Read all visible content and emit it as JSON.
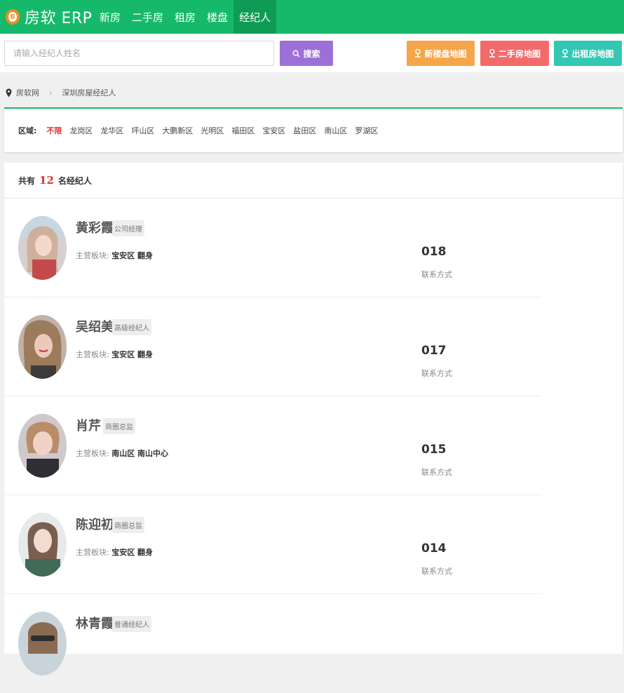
{
  "nav": {
    "brand": "房软 ERP",
    "logo_glyph": "8",
    "items": [
      {
        "label": "新房",
        "active": false
      },
      {
        "label": "二手房",
        "active": false
      },
      {
        "label": "租房",
        "active": false
      },
      {
        "label": "楼盘",
        "active": false
      },
      {
        "label": "经纪人",
        "active": true
      }
    ]
  },
  "search": {
    "placeholder": "请输入经纪人姓名",
    "button": "搜索",
    "map_buttons": {
      "new": "新楼盘地图",
      "second": "二手房地图",
      "rent": "出租房地图"
    }
  },
  "breadcrumb": {
    "home": "房软网",
    "current": "深圳房屋经纪人"
  },
  "region": {
    "label": "区域:",
    "items": [
      "不限",
      "龙岗区",
      "龙华区",
      "坪山区",
      "大鹏新区",
      "光明区",
      "福田区",
      "宝安区",
      "盐田区",
      "南山区",
      "罗湖区"
    ],
    "active_index": 0
  },
  "list": {
    "count_prefix": "共有",
    "count": "12",
    "count_suffix": "名经纪人",
    "area_label": "主营板块:",
    "contact_label": "联系方式",
    "agents": [
      {
        "name": "黄彩霞",
        "title": "公司经理",
        "area": "宝安区 翻身",
        "code": "018"
      },
      {
        "name": "吴绍美",
        "title": "高级经纪人",
        "area": "宝安区 翻身",
        "code": "017"
      },
      {
        "name": "肖芹",
        "title": "商圈总监",
        "area": "南山区 南山中心",
        "code": "015"
      },
      {
        "name": "陈迎初",
        "title": "商圈总监",
        "area": "宝安区 翻身",
        "code": "014"
      },
      {
        "name": "林青霞",
        "title": "普通经纪人",
        "area": "",
        "code": ""
      }
    ]
  },
  "colors": {
    "brand_green": "#16b96a",
    "search_purple": "#9d70d8",
    "map_orange": "#f5a64a",
    "map_red": "#f26b6b",
    "map_teal": "#34c8b4",
    "highlight_red": "#e03333"
  }
}
